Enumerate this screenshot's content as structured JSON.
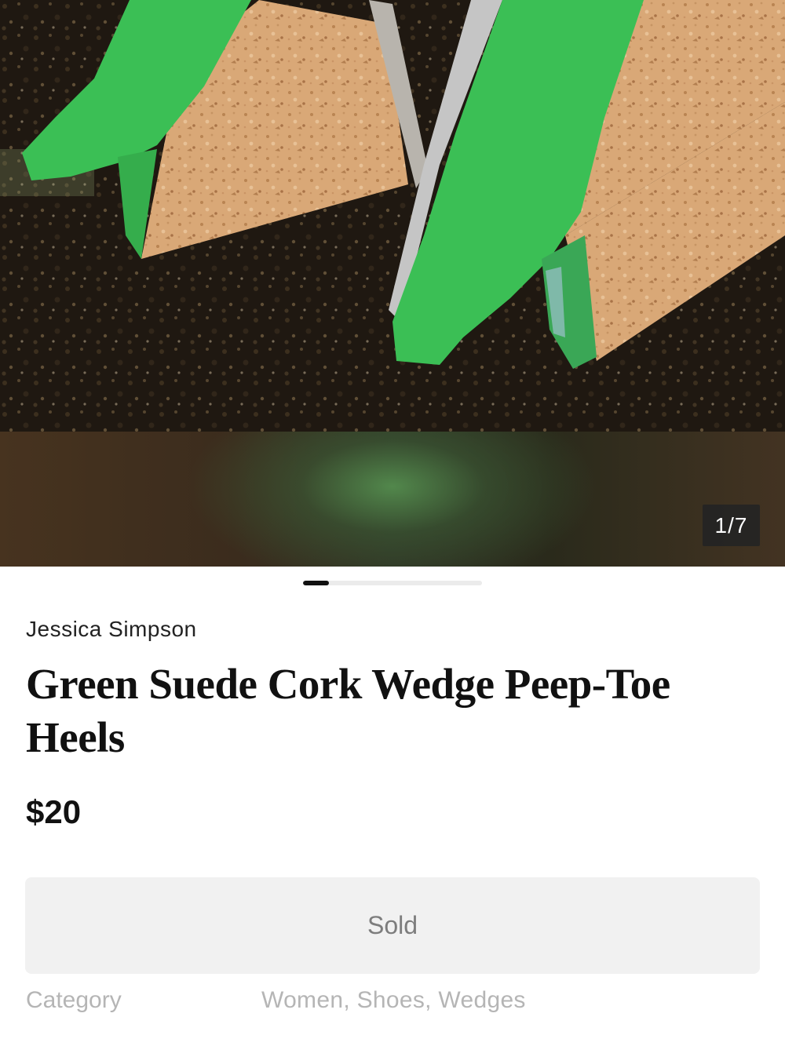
{
  "listing": {
    "brand": "Jessica Simpson",
    "title": "Green Suede Cork Wedge Peep-Toe Heels",
    "price": "$20",
    "status_button": "Sold"
  },
  "gallery": {
    "counter": "1/7",
    "current": 1,
    "total": 7,
    "image_icon": "product-photo"
  },
  "details": {
    "category_label": "Category",
    "category_value": "Women, Shoes, Wedges"
  },
  "colors": {
    "suede_green": "#3bbf55",
    "cork": "#d9a877",
    "sold_text": "#7d7d7d",
    "sold_bg": "#f1f1f1"
  }
}
